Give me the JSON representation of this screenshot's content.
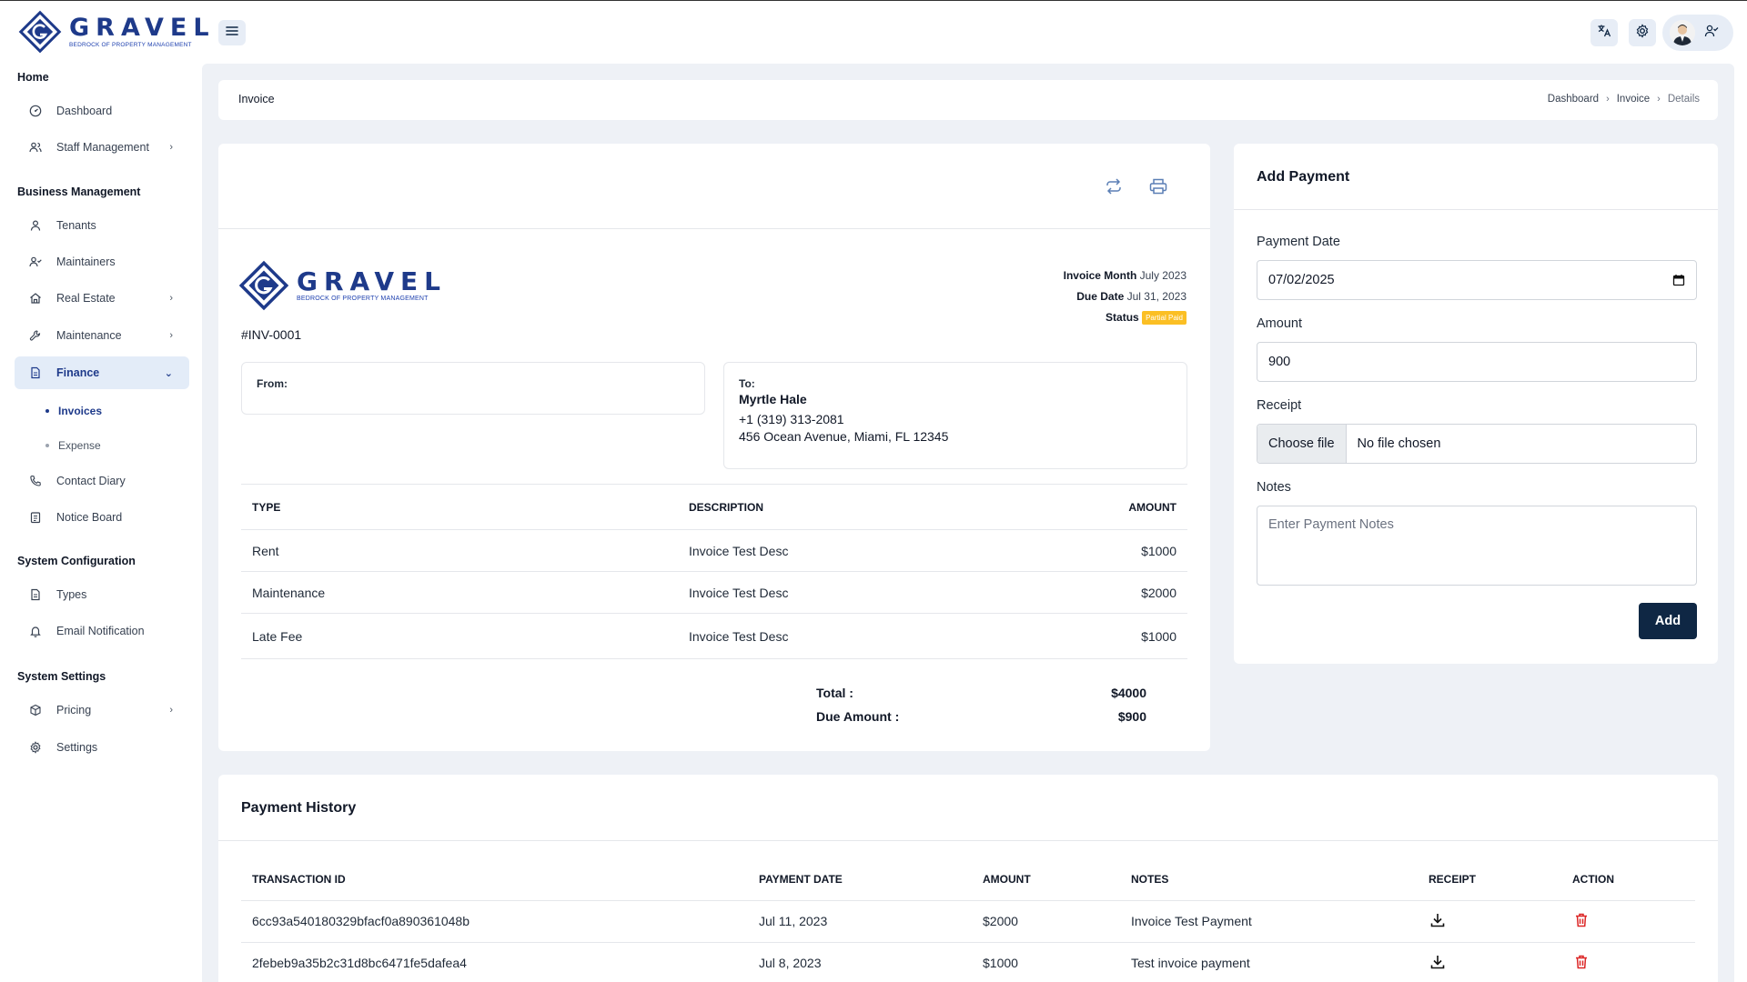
{
  "brand": {
    "name": "GRAVEL",
    "tagline": "BEDROCK OF PROPERTY MANAGEMENT",
    "colors": {
      "primary": "#1e3a8a",
      "dark_button": "#0f2744",
      "badge": "#fbbf24",
      "delete": "#dc2626",
      "content_bg": "#eef1f6"
    }
  },
  "topbar": {
    "icons": [
      "menu-icon",
      "translate-icon",
      "gear-icon",
      "user-check-icon"
    ]
  },
  "sidebar": {
    "sections": {
      "home": "Home",
      "business": "Business Management",
      "sysconfig": "System Configuration",
      "syssettings": "System Settings"
    },
    "items": {
      "dashboard": "Dashboard",
      "staff": "Staff Management",
      "tenants": "Tenants",
      "maintainers": "Maintainers",
      "real_estate": "Real Estate",
      "maintenance": "Maintenance",
      "finance": "Finance",
      "invoices": "Invoices",
      "expense": "Expense",
      "contact": "Contact Diary",
      "notice": "Notice Board",
      "types": "Types",
      "email": "Email Notification",
      "pricing": "Pricing",
      "settings": "Settings"
    }
  },
  "page": {
    "title": "Invoice",
    "breadcrumb": [
      "Dashboard",
      "Invoice",
      "Details"
    ]
  },
  "invoice": {
    "month_label": "Invoice Month",
    "month_value": "July 2023",
    "due_label": "Due Date",
    "due_value": "Jul 31, 2023",
    "status_label": "Status",
    "status_value": "Partial Paid",
    "number": "#INV-0001",
    "from_label": "From:",
    "to_label": "To:",
    "to_name": "Myrtle Hale",
    "to_phone": "+1 (319) 313-2081",
    "to_address": "456 Ocean Avenue, Miami, FL 12345",
    "columns": {
      "type": "TYPE",
      "description": "DESCRIPTION",
      "amount": "AMOUNT"
    },
    "rows": [
      {
        "type": "Rent",
        "description": "Invoice Test Desc",
        "amount": "$1000"
      },
      {
        "type": "Maintenance",
        "description": "Invoice Test Desc",
        "amount": "$2000"
      },
      {
        "type": "Late Fee",
        "description": "Invoice Test Desc",
        "amount": "$1000"
      }
    ],
    "total_label": "Total :",
    "total_value": "$4000",
    "due_amount_label": "Due Amount :",
    "due_amount_value": "$900"
  },
  "payment_form": {
    "title": "Add Payment",
    "date_label": "Payment Date",
    "date_value": "07/02/2025",
    "amount_label": "Amount",
    "amount_value": "900",
    "receipt_label": "Receipt",
    "file_button": "Choose file",
    "file_status": "No file chosen",
    "notes_label": "Notes",
    "notes_placeholder": "Enter Payment Notes",
    "submit": "Add"
  },
  "history": {
    "title": "Payment History",
    "columns": {
      "id": "TRANSACTION ID",
      "date": "PAYMENT DATE",
      "amount": "AMOUNT",
      "notes": "NOTES",
      "receipt": "RECEIPT",
      "action": "ACTION"
    },
    "rows": [
      {
        "id": "6cc93a540180329bfacf0a890361048b",
        "date": "Jul 11, 2023",
        "amount": "$2000",
        "notes": "Invoice Test Payment"
      },
      {
        "id": "2febeb9a35b2c31d8bc6471fe5dafea4",
        "date": "Jul 8, 2023",
        "amount": "$1000",
        "notes": "Test invoice payment"
      }
    ]
  }
}
